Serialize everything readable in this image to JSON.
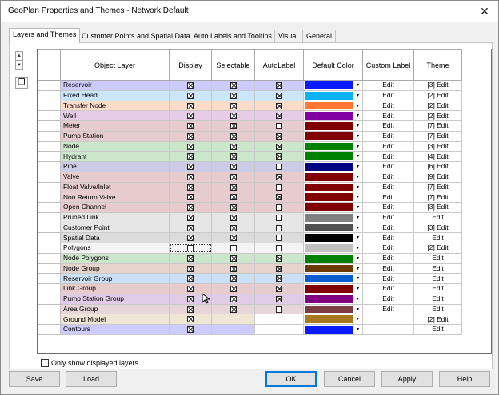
{
  "window": {
    "title": "GeoPlan Properties and Themes - Network Default",
    "close_glyph": "✕"
  },
  "tabs": [
    {
      "label": "Layers and Themes",
      "active": true
    },
    {
      "label": "Customer Points and Spatial Data",
      "active": false
    },
    {
      "label": "Auto Labels and Tooltips",
      "active": false
    },
    {
      "label": "Visual",
      "active": false
    },
    {
      "label": "General",
      "active": false
    }
  ],
  "columns": [
    "Object Layer",
    "Display",
    "Selectable",
    "AutoLabel",
    "Default Color",
    "Custom Label",
    "Theme"
  ],
  "layers": [
    {
      "name": "Reservoir",
      "bg": "#ccccff",
      "display": true,
      "selectable": true,
      "autolabel": true,
      "color": "#0a1aff",
      "custom_label": "Edit",
      "theme": "[3] Edit"
    },
    {
      "name": "Fixed Head",
      "bg": "#cce6ff",
      "display": true,
      "selectable": true,
      "autolabel": true,
      "color": "#0bb3f5",
      "custom_label": "Edit",
      "theme": "[2] Edit"
    },
    {
      "name": "Transfer Node",
      "bg": "#ffdcca",
      "display": true,
      "selectable": true,
      "autolabel": true,
      "color": "#ff7733",
      "custom_label": "Edit",
      "theme": "[2] Edit"
    },
    {
      "name": "Well",
      "bg": "#e6cce6",
      "display": true,
      "selectable": true,
      "autolabel": true,
      "color": "#8000a0",
      "custom_label": "Edit",
      "theme": "[2] Edit"
    },
    {
      "name": "Meter",
      "bg": "#e6cccc",
      "display": true,
      "selectable": true,
      "autolabel": false,
      "color": "#800000",
      "custom_label": "Edit",
      "theme": "[7] Edit"
    },
    {
      "name": "Pump Station",
      "bg": "#e6cccc",
      "display": true,
      "selectable": true,
      "autolabel": true,
      "color": "#800000",
      "custom_label": "Edit",
      "theme": "[7] Edit"
    },
    {
      "name": "Node",
      "bg": "#cce6cc",
      "display": true,
      "selectable": true,
      "autolabel": true,
      "color": "#008000",
      "custom_label": "Edit",
      "theme": "[3] Edit"
    },
    {
      "name": "Hydrant",
      "bg": "#cce6cc",
      "display": true,
      "selectable": true,
      "autolabel": true,
      "color": "#008000",
      "custom_label": "Edit",
      "theme": "[4] Edit"
    },
    {
      "name": "Pipe",
      "bg": "#cccce6",
      "display": true,
      "selectable": true,
      "autolabel": false,
      "color": "#000080",
      "custom_label": "Edit",
      "theme": "[6] Edit"
    },
    {
      "name": "Valve",
      "bg": "#e6cccc",
      "display": true,
      "selectable": true,
      "autolabel": true,
      "color": "#800000",
      "custom_label": "Edit",
      "theme": "[9] Edit"
    },
    {
      "name": "Float Valve/Inlet",
      "bg": "#e6cccc",
      "display": true,
      "selectable": true,
      "autolabel": false,
      "color": "#800000",
      "custom_label": "Edit",
      "theme": "[7] Edit"
    },
    {
      "name": "Non Return Valve",
      "bg": "#e6cccc",
      "display": true,
      "selectable": true,
      "autolabel": true,
      "color": "#800000",
      "custom_label": "Edit",
      "theme": "[7] Edit"
    },
    {
      "name": "Open Channel",
      "bg": "#e6cccc",
      "display": true,
      "selectable": true,
      "autolabel": false,
      "color": "#800000",
      "custom_label": "Edit",
      "theme": "[3] Edit"
    },
    {
      "name": "Pruned Link",
      "bg": "#e6e6e6",
      "display": true,
      "selectable": true,
      "autolabel": false,
      "color": "#808080",
      "custom_label": "Edit",
      "theme": "Edit"
    },
    {
      "name": "Customer Point",
      "bg": "#e6e6e6",
      "display": true,
      "selectable": true,
      "autolabel": false,
      "color": "#505050",
      "custom_label": "Edit",
      "theme": "[3] Edit"
    },
    {
      "name": "Spatial Data",
      "bg": "#dcdcdc",
      "display": true,
      "selectable": true,
      "autolabel": false,
      "color": "#000000",
      "custom_label": "Edit",
      "theme": "Edit"
    },
    {
      "name": "Polygons",
      "bg": "#f4f4f4",
      "display": false,
      "selectable": false,
      "autolabel": false,
      "color": "#c0c0c0",
      "custom_label": "Edit",
      "theme": "[2] Edit",
      "focus": true
    },
    {
      "name": "Node Polygons",
      "bg": "#cce6cc",
      "display": true,
      "selectable": true,
      "autolabel": true,
      "color": "#008000",
      "custom_label": "Edit",
      "theme": "Edit"
    },
    {
      "name": "Node Group",
      "bg": "#e6d4cc",
      "display": true,
      "selectable": true,
      "autolabel": true,
      "color": "#6b3a00",
      "custom_label": "Edit",
      "theme": "Edit"
    },
    {
      "name": "Reservoir Group",
      "bg": "#cce0f5",
      "display": true,
      "selectable": true,
      "autolabel": true,
      "color": "#0a5bcf",
      "custom_label": "Edit",
      "theme": "Edit"
    },
    {
      "name": "Link Group",
      "bg": "#e6cccc",
      "display": true,
      "selectable": true,
      "autolabel": true,
      "color": "#800000",
      "custom_label": "Edit",
      "theme": "Edit"
    },
    {
      "name": "Pump Station Group",
      "bg": "#e0cce6",
      "display": true,
      "selectable": true,
      "autolabel": true,
      "color": "#800080",
      "custom_label": "Edit",
      "theme": "Edit"
    },
    {
      "name": "Area Group",
      "bg": "#e6d6d8",
      "display": true,
      "selectable": true,
      "autolabel": false,
      "color": "#7a3e44",
      "custom_label": "Edit",
      "theme": "Edit"
    },
    {
      "name": "Ground Model",
      "bg": "#f0e6d6",
      "display": true,
      "selectable": null,
      "autolabel": null,
      "color": "#a67820",
      "custom_label": "",
      "theme": "[2] Edit"
    },
    {
      "name": "Contours",
      "bg": "#ccccff",
      "display": true,
      "selectable": null,
      "autolabel": null,
      "color": "#0a1aff",
      "custom_label": "",
      "theme": "Edit"
    }
  ],
  "only_show_displayed": {
    "label": "Only show displayed layers",
    "checked": false
  },
  "buttons": {
    "save": "Save",
    "load": "Load",
    "ok": "OK",
    "cancel": "Cancel",
    "apply": "Apply",
    "help": "Help"
  },
  "spin_up": "▲",
  "spin_down": "▼",
  "dropdown_glyph": "▾"
}
